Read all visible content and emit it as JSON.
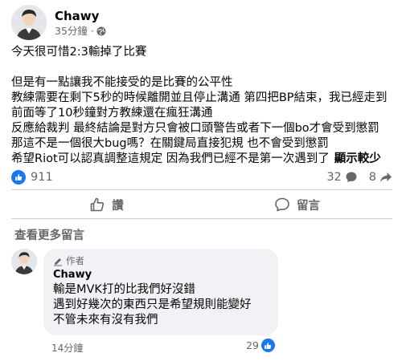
{
  "post": {
    "author": "Chawy",
    "time": "35分鐘 ·",
    "line1": "今天很可惜2:3輸掉了比賽",
    "lines": [
      "但是有一點讓我不能接受的是比賽的公平性",
      "教練需要在剩下5秒的時候離開並且停止溝通 第四把BP結束，我已經走到前面等了10秒鐘對方教練還在瘋狂溝通",
      "反應給裁判 最終結論是對方只會被口頭警告或者下一個bo才會受到懲罰",
      "那這不是一個很大bug嗎？在關鍵局直接犯規 也不會受到懲罰",
      "希望Riot可以認真調整這規定 因為我們已經不是第一次遇到了"
    ],
    "see_less": "顯示較少"
  },
  "stats": {
    "likes": "911",
    "comments": "32",
    "shares": "8"
  },
  "actions": {
    "like_label": "讚",
    "comment_label": "留言"
  },
  "more_comments": "查看更多留言",
  "comment": {
    "badge": "作者",
    "author": "Chawy",
    "lines": [
      "輸是MVK打的比我們好沒錯",
      "遇到好幾次的東西只是希望規則能變好",
      "不管未來有沒有我們"
    ],
    "time": "14分鐘",
    "likes": "29"
  },
  "colors": {
    "accent": "#1877f2",
    "secondary_text": "#65676b",
    "bubble": "#f0f2f5"
  }
}
